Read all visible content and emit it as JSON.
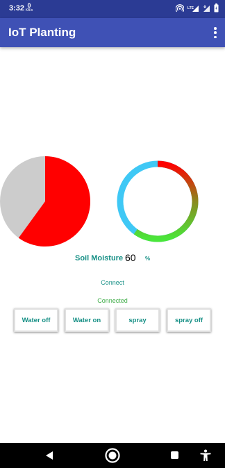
{
  "status_bar": {
    "time": "3:32",
    "speed_value": "0",
    "speed_unit": "KB/s",
    "network_type": "LTE",
    "icons": [
      "hotspot-icon",
      "lte-signal-icon",
      "signal-icon",
      "battery-icon"
    ]
  },
  "app_bar": {
    "title": "IoT Planting",
    "menu_icon": "overflow-menu-icon"
  },
  "charts": {
    "pie": {
      "fill_percent": 60,
      "fill_color": "#ff0000",
      "empty_color": "#cccccc"
    },
    "ring": {
      "progress_percent": 60,
      "gradient_colors": [
        "#ff0000",
        "#8a8a1e",
        "#4ae63a"
      ],
      "track_color": "#3fc8f5"
    }
  },
  "soil_moisture": {
    "label": "Soil Moisture",
    "value": "60",
    "unit": "%"
  },
  "connection": {
    "link_label": "Connect",
    "status_text": "Connected"
  },
  "buttons": {
    "water_off": "Water off",
    "water_on": "Water on",
    "spray": "spray",
    "spray_off": "spray off"
  },
  "colors": {
    "app_bar": "#3f51b5",
    "status_bar": "#2b3b94",
    "accent_text": "#158f85",
    "status_green": "#3dac46"
  },
  "nav_bar": {
    "icons": [
      "back-icon",
      "home-icon",
      "recents-icon",
      "accessibility-icon"
    ]
  }
}
